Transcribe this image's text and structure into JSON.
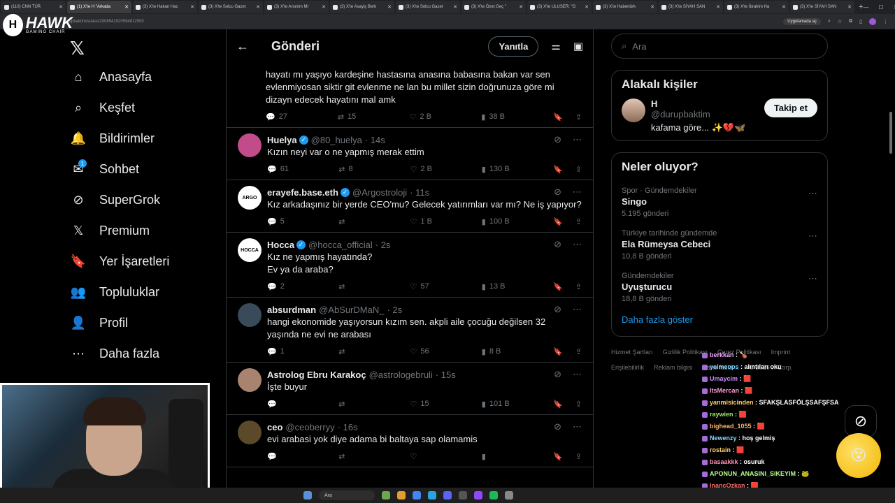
{
  "browser": {
    "tabs": [
      {
        "label": "(110) CNN TÜR"
      },
      {
        "label": "(1) X'te H \"Arkada"
      },
      {
        "label": "(3) X'te Hakan Hac"
      },
      {
        "label": "(3) X'te Solcu Gazet"
      },
      {
        "label": "(3) X'te Anonim Mi"
      },
      {
        "label": "(3) X'te Asayiş Berk"
      },
      {
        "label": "(3) X'te Solcu Gazet"
      },
      {
        "label": "(3) X'te Özet Geç \""
      },
      {
        "label": "(3) X'te ULUSER: \"G"
      },
      {
        "label": "(3) X'te Habertürk"
      },
      {
        "label": "(3) X'te SİYAH SAN"
      },
      {
        "label": "(3) X'te İbrahim Ha"
      },
      {
        "label": "(3) X'te SİYAH SAN"
      }
    ],
    "url": "durupbaktim/status/2008941520594812993",
    "install_label": "Uygulamada aç"
  },
  "overlay_brand": {
    "name": "HAWK",
    "sub": "GAMING CHAIR"
  },
  "nav": {
    "items": [
      {
        "label": "Anasayfa"
      },
      {
        "label": "Keşfet"
      },
      {
        "label": "Bildirimler"
      },
      {
        "label": "Sohbet",
        "badge": "1"
      },
      {
        "label": "SuperGrok"
      },
      {
        "label": "Premium"
      },
      {
        "label": "Yer İşaretleri"
      },
      {
        "label": "Topluluklar"
      },
      {
        "label": "Profil"
      },
      {
        "label": "Daha fazla"
      }
    ]
  },
  "main": {
    "title": "Gönderi",
    "reply_label": "Yanıtla",
    "top_text": "hayatı mı yaşıyo kardeşine hastasına anasına babasına bakan var sen\nevlenmiyosan siktir git evlenme ne lan bu millet sizin doğrunuza göre mi\ndizayn edecek hayatını mal amk",
    "top_stats": {
      "replies": "27",
      "reposts": "15",
      "likes": "2 B",
      "views": "38 B"
    },
    "tweets": [
      {
        "name": "Huelya",
        "verified": true,
        "handle": "@80_huelya",
        "time": "· 14s",
        "text": "Kızın neyi var o ne yapmış merak ettim",
        "replies": "61",
        "reposts": "8",
        "likes": "2 B",
        "views": "130 B",
        "avatar_color": "#c24b8a",
        "avatar_text": ""
      },
      {
        "name": "erayefe.base.eth",
        "verified": true,
        "handle": "@Argostroloji",
        "time": "· 11s",
        "text": "Kız arkadaşınız bir yerde CEO'mu? Gelecek yatırımları var mı? Ne iş yapıyor?",
        "replies": "5",
        "reposts": "",
        "likes": "1 B",
        "views": "100 B",
        "avatar_color": "#ffffff",
        "avatar_text": "ARGO"
      },
      {
        "name": "Hocca",
        "verified": true,
        "handle": "@hocca_official",
        "time": "· 2s",
        "text": "Kız ne yapmış hayatında?\nEv ya da araba?",
        "replies": "2",
        "reposts": "",
        "likes": "57",
        "views": "13 B",
        "avatar_color": "#ffffff",
        "avatar_text": "HOCCA"
      },
      {
        "name": "absurdman",
        "verified": false,
        "handle": "@AbSurDMaN_",
        "time": "· 2s",
        "text": "hangi ekonomide yaşıyorsun kızım sen. akpli aile çocuğu değilsen 32\nyaşında ne evi ne arabası",
        "replies": "1",
        "reposts": "",
        "likes": "56",
        "views": "8 B",
        "avatar_color": "#3a4a5a",
        "avatar_text": ""
      },
      {
        "name": "Astrolog Ebru Karakoç",
        "verified": false,
        "handle": "@astrologebruli",
        "time": "· 15s",
        "text": "İşte buyur",
        "replies": "",
        "reposts": "",
        "likes": "15",
        "views": "101 B",
        "avatar_color": "#a88470",
        "avatar_text": ""
      },
      {
        "name": "ceo",
        "verified": false,
        "handle": "@ceoberryy",
        "time": "· 16s",
        "text": "evi arabasi yok diye adama bi baltaya sap olamamis",
        "replies": "",
        "reposts": "",
        "likes": "",
        "views": "",
        "avatar_color": "#5a4a2a",
        "avatar_text": ""
      }
    ]
  },
  "right": {
    "search_placeholder": "Ara",
    "related_title": "Alakalı kişiler",
    "person": {
      "name": "H",
      "handle": "@durupbaktim",
      "bio": "kafama göre... ✨💔🦋",
      "follow_label": "Takip et"
    },
    "trends_title": "Neler oluyor?",
    "trends": [
      {
        "category": "Spor · Gündemdekiler",
        "name": "Singo",
        "count": "5.195 gönderi"
      },
      {
        "category": "Türkiye tarihinde gündemde",
        "name": "Ela Rümeysa Cebeci",
        "count": "10,8 B gönderi"
      },
      {
        "category": "Gündemdekiler",
        "name": "Uyuşturucu",
        "count": "18,8 B gönderi"
      }
    ],
    "show_more": "Daha fazla göster",
    "footer": [
      "Hizmet Şartları",
      "Gizlilik Politikası",
      "Çerez Politikası",
      "Imprint",
      "Erişilebilirlik",
      "Reklam bilgisi",
      "Daha fazla ...",
      "© 2026 X Corp."
    ]
  },
  "chat": [
    {
      "user": "berkkan",
      "msg": "🍗",
      "color": "#f4a6ff"
    },
    {
      "user": "yelmeops",
      "msg": "alıntıları oku",
      "color": "#7ad3ff"
    },
    {
      "user": "Umaycim",
      "msg": "🟥",
      "color": "#c78bff"
    },
    {
      "user": "ItsMercan",
      "msg": "🟥",
      "color": "#ff9ad6"
    },
    {
      "user": "yanmisicinden",
      "msg": "SFAKŞLASFÖLŞSAFŞFSA",
      "color": "#ffd16b"
    },
    {
      "user": "raywien",
      "msg": "🟥",
      "color": "#9fe870"
    },
    {
      "user": "bighead_1055",
      "msg": "🟥",
      "color": "#ffb36b"
    },
    {
      "user": "Newenzy",
      "msg": "hoş gelmiş",
      "color": "#8ad8ff"
    },
    {
      "user": "rostain",
      "msg": "🟥",
      "color": "#ffd16b"
    },
    {
      "user": "basaakkk",
      "msg": "osuruk",
      "color": "#ff8fb3"
    },
    {
      "user": "APONUN_ANASINI_SIKEYIM",
      "msg": "🐸",
      "color": "#b2ff8a"
    },
    {
      "user": "InancOzkan",
      "msg": "🟥",
      "color": "#ff6b6b"
    }
  ],
  "taskbar": {
    "search": "Ara"
  },
  "colors": {
    "accent": "#1d9bf0",
    "bg": "#000000",
    "border": "#2f3336",
    "muted": "#71767b"
  }
}
